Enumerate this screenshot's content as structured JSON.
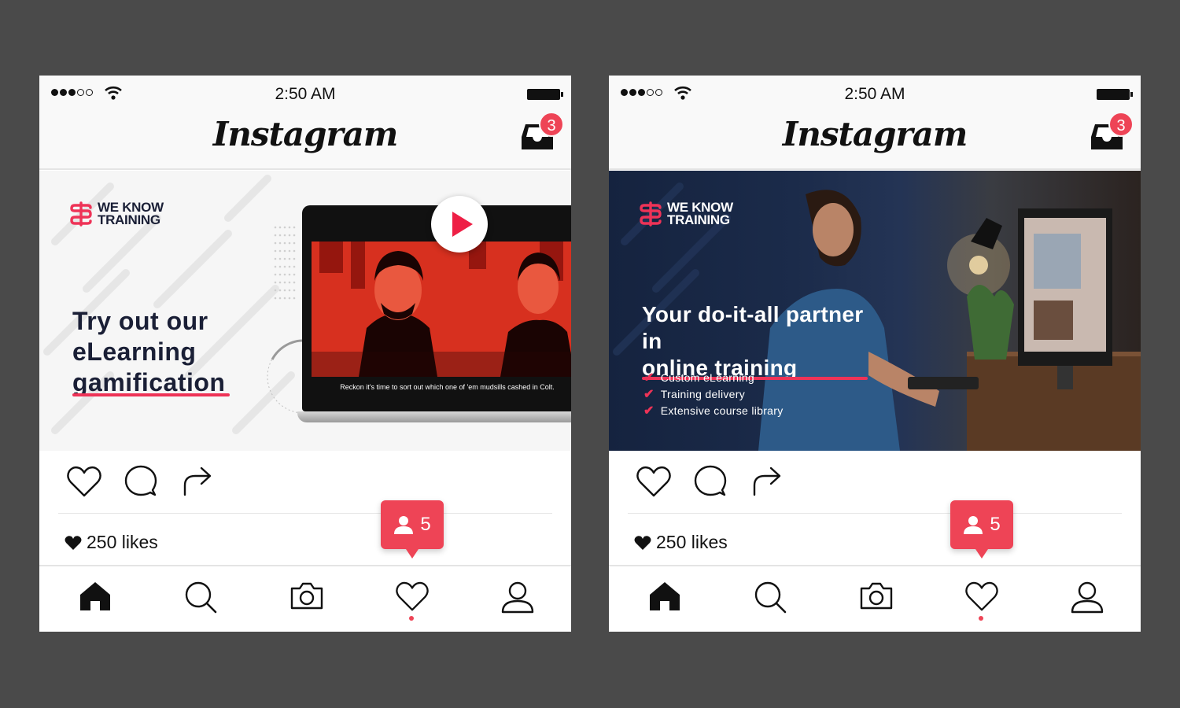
{
  "phones": [
    {
      "status": {
        "time": "2:50 AM"
      },
      "header": {
        "logo": "Instagram",
        "inbox_badge": "3"
      },
      "post": {
        "brand_line1": "WE KNOW",
        "brand_line2": "TRAINING",
        "headline_line1": "Try out our",
        "headline_line2": "eLearning",
        "headline_line3": "gamification",
        "video_caption": "Reckon it's time to sort out which one of 'em mudsills cashed in Colt."
      },
      "likes": "250 likes",
      "notification_count": "5"
    },
    {
      "status": {
        "time": "2:50 AM"
      },
      "header": {
        "logo": "Instagram",
        "inbox_badge": "3"
      },
      "post": {
        "brand_line1": "WE KNOW",
        "brand_line2": "TRAINING",
        "headline_line1": "Your do-it-all partner",
        "headline_line2_prefix": "in ",
        "headline_line2_highlight": "online training",
        "checklist": [
          "Custom eLearning",
          "Training delivery",
          "Extensive course library"
        ]
      },
      "likes": "250 likes",
      "notification_count": "5"
    }
  ],
  "colors": {
    "background": "#4a4a4a",
    "accent": "#ee4456",
    "brand_navy": "#1a1f36"
  },
  "icons": {
    "status": [
      "signal-icon",
      "wifi-icon",
      "battery-icon"
    ],
    "header": [
      "inbox-icon"
    ],
    "actions": [
      "heart-icon",
      "comment-icon",
      "share-icon"
    ],
    "nav": [
      "home-icon",
      "search-icon",
      "camera-icon",
      "activity-heart-icon",
      "profile-icon"
    ]
  }
}
